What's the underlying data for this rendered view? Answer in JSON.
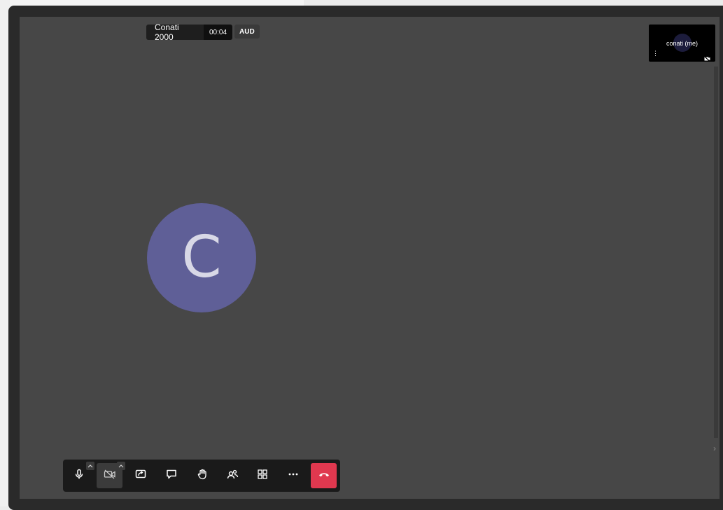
{
  "meeting": {
    "title": "Conati 2000",
    "timer": "00:04",
    "badge": "AUD"
  },
  "participant": {
    "initial": "C"
  },
  "self_view": {
    "name": "conati (me)",
    "menu_glyph": "⋮"
  },
  "toolbar": {
    "buttons": [
      {
        "name": "microphone",
        "icon": "mic-icon"
      },
      {
        "name": "camera",
        "icon": "video-off-icon",
        "active": true
      },
      {
        "name": "share-screen",
        "icon": "screen-share-icon"
      },
      {
        "name": "chat",
        "icon": "chat-icon"
      },
      {
        "name": "raise-hand",
        "icon": "hand-icon"
      },
      {
        "name": "participants",
        "icon": "participants-icon"
      },
      {
        "name": "tile-view",
        "icon": "grid-icon"
      },
      {
        "name": "more",
        "icon": "more-icon"
      },
      {
        "name": "leave",
        "icon": "hangup-icon"
      }
    ]
  },
  "colors": {
    "avatar": "#5f5f97",
    "hangup": "#e0384f",
    "stage": "#474747"
  }
}
